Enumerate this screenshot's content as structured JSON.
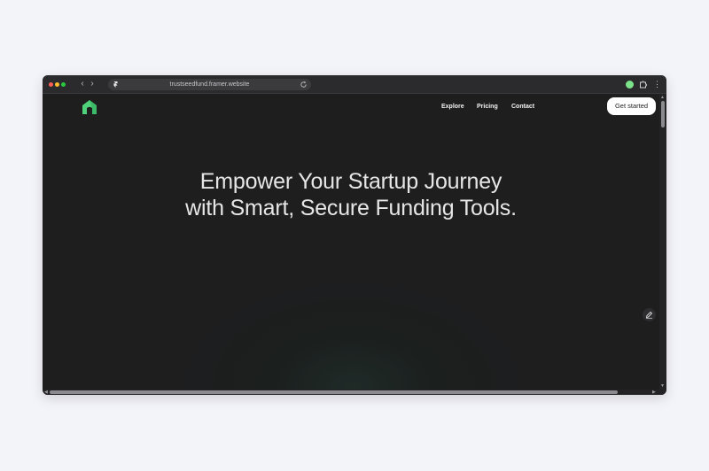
{
  "browser": {
    "url": "trustseedfund.framer.website",
    "back_glyph": "‹",
    "forward_glyph": "›",
    "menu_glyph": "⋮"
  },
  "site": {
    "logo_icon": "house-arch-logo-icon",
    "nav": {
      "explore": "Explore",
      "pricing": "Pricing",
      "contact": "Contact"
    },
    "cta_label": "Get started",
    "hero": {
      "line1": "Empower Your Startup Journey",
      "line2": "with Smart, Secure Funding Tools."
    }
  },
  "scrollbars": {
    "up": "▲",
    "down": "▼",
    "left": "◀",
    "right": "▶"
  },
  "colors": {
    "page_bg": "#1e1e1f",
    "logo_green": "#4fd07a",
    "cta_bg": "#ffffff",
    "hero_text": "#e6e6e6"
  }
}
